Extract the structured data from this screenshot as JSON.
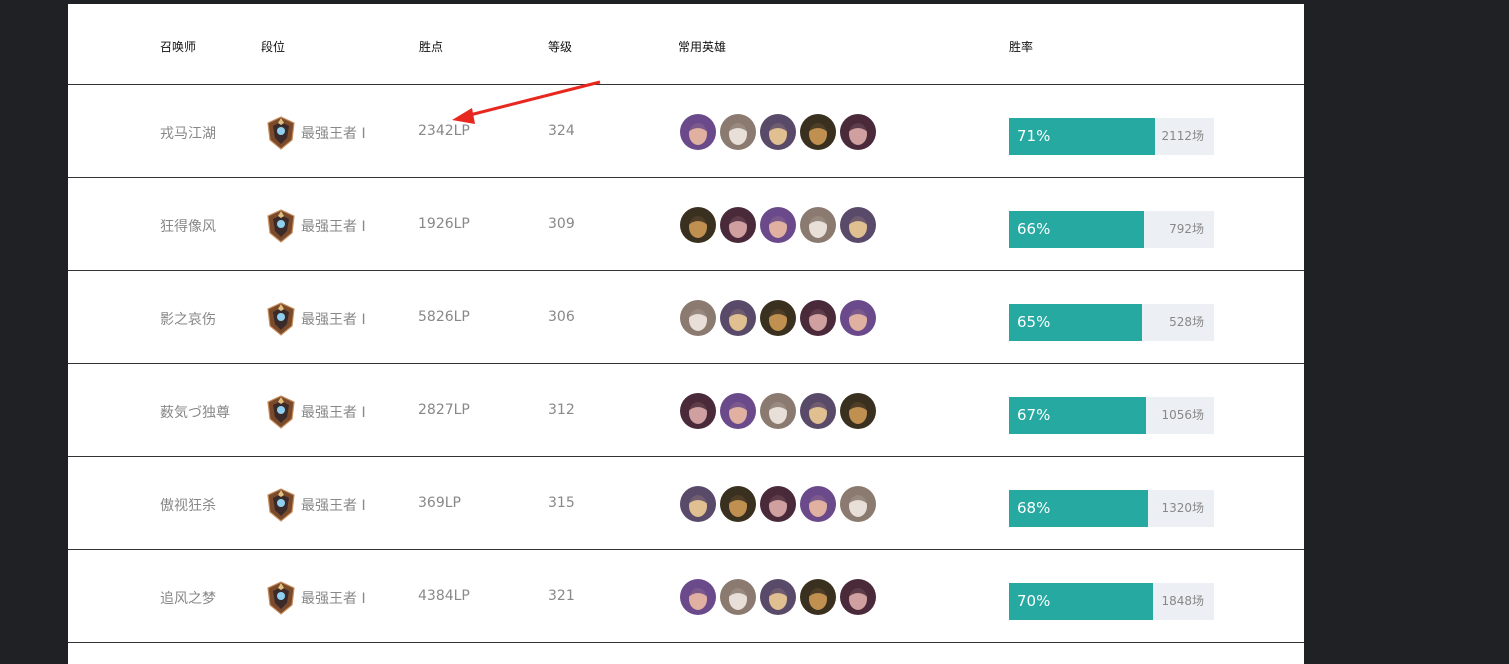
{
  "header": {
    "summoner": "召唤师",
    "tier": "段位",
    "lp": "胜点",
    "level": "等级",
    "champions": "常用英雄",
    "winrate": "胜率"
  },
  "colors": {
    "bar": "#26a9a0",
    "bar_bg": "#eceff4",
    "arrow": "#e8281e"
  },
  "rows": [
    {
      "name": "戎马江湖",
      "tier": "最强王者 I",
      "lp": "2342LP",
      "level": "324",
      "winrate": "71%",
      "win_fraction": 0.71,
      "games": "2112场",
      "champions": [
        "champion-portrait-1",
        "champion-portrait-2",
        "champion-portrait-3",
        "champion-portrait-4",
        "champion-portrait-5"
      ]
    },
    {
      "name": "狂得像风",
      "tier": "最强王者 I",
      "lp": "1926LP",
      "level": "309",
      "winrate": "66%",
      "win_fraction": 0.66,
      "games": "792场",
      "champions": [
        "champion-portrait-1",
        "champion-portrait-2",
        "champion-portrait-3",
        "champion-portrait-4",
        "champion-portrait-5"
      ]
    },
    {
      "name": "影之哀伤",
      "tier": "最强王者 I",
      "lp": "5826LP",
      "level": "306",
      "winrate": "65%",
      "win_fraction": 0.65,
      "games": "528场",
      "champions": [
        "champion-portrait-1",
        "champion-portrait-2",
        "champion-portrait-3",
        "champion-portrait-4",
        "champion-portrait-5"
      ]
    },
    {
      "name": "薮気づ独尊",
      "tier": "最强王者 I",
      "lp": "2827LP",
      "level": "312",
      "winrate": "67%",
      "win_fraction": 0.67,
      "games": "1056场",
      "champions": [
        "champion-portrait-1",
        "champion-portrait-2",
        "champion-portrait-3",
        "champion-portrait-4",
        "champion-portrait-5"
      ]
    },
    {
      "name": "傲视狂杀",
      "tier": "最强王者 I",
      "lp": "369LP",
      "level": "315",
      "winrate": "68%",
      "win_fraction": 0.68,
      "games": "1320场",
      "champions": [
        "champion-portrait-1",
        "champion-portrait-2",
        "champion-portrait-3",
        "champion-portrait-4",
        "champion-portrait-5"
      ]
    },
    {
      "name": "追风之梦",
      "tier": "最强王者 I",
      "lp": "4384LP",
      "level": "321",
      "winrate": "70%",
      "win_fraction": 0.7,
      "games": "1848场",
      "champions": [
        "champion-portrait-1",
        "champion-portrait-2",
        "champion-portrait-3",
        "champion-portrait-4",
        "champion-portrait-5"
      ]
    }
  ]
}
